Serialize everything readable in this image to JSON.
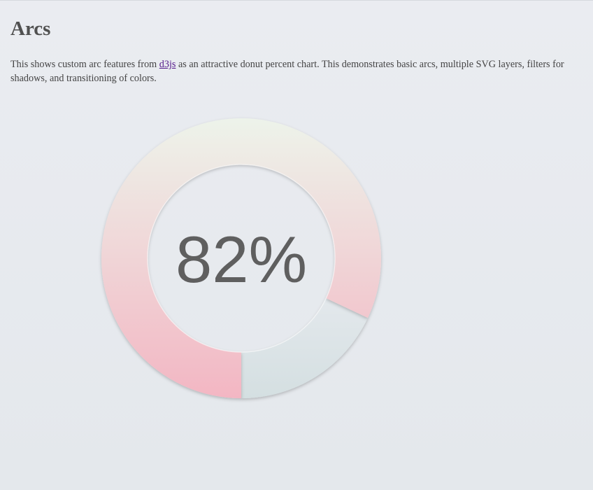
{
  "page": {
    "title": "Arcs",
    "intro_before": "This shows custom arc features from ",
    "intro_link": "d3js",
    "intro_after": " as an attractive donut percent chart. This demonstrates basic arcs, multiple SVG layers, filters for shadows, and transitioning of colors."
  },
  "chart_data": {
    "type": "pie",
    "variant": "donut",
    "percent": 82,
    "label": "82%",
    "title": "",
    "series": [
      {
        "values": [
          82,
          18
        ]
      }
    ],
    "colors": {
      "fill_top": "#edf3ea",
      "fill_bottom": "#f3b6c3",
      "remainder_top": "#e3e8ec",
      "remainder_bottom": "#d4dfe1",
      "label": "#5f5f5f"
    }
  }
}
